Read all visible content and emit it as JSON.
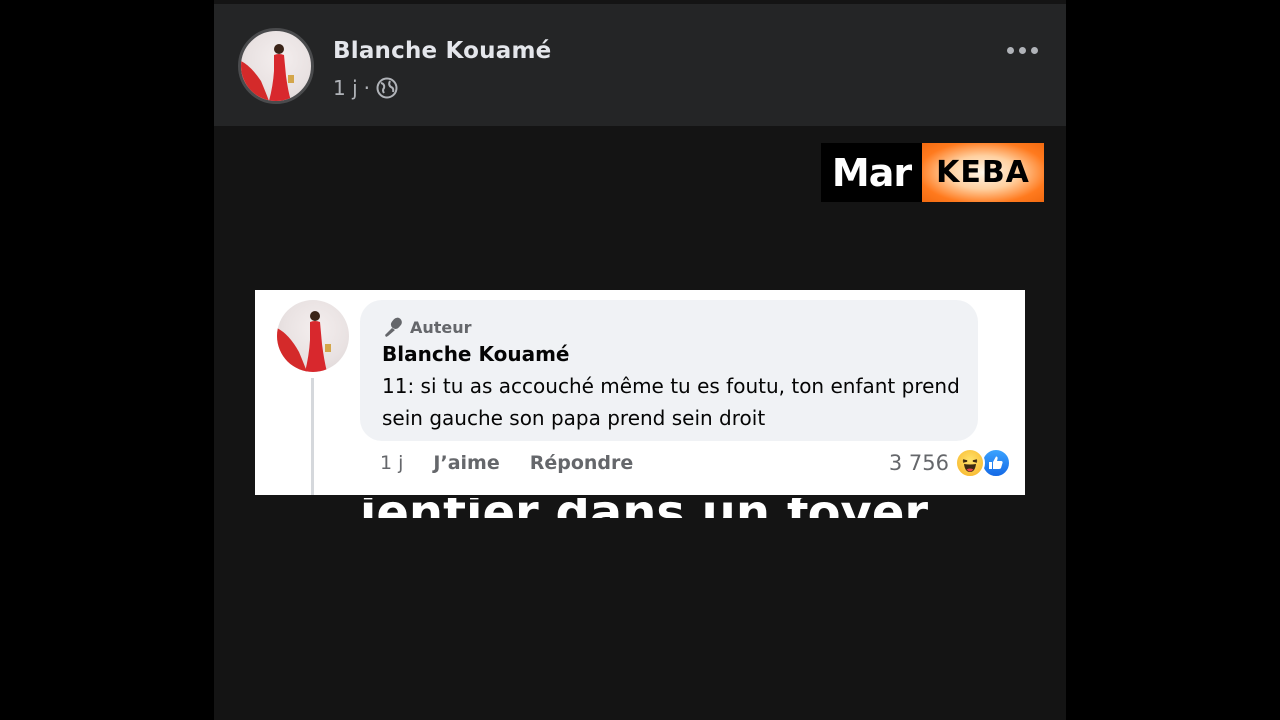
{
  "post": {
    "author": "Blanche Kouamé",
    "time": "1 j",
    "separator": "·",
    "privacy_icon": "globe-icon",
    "menu_icon": "more-horizontal-icon"
  },
  "logo": {
    "left_text": "Mar",
    "right_text": "KEBA"
  },
  "background_caption": "ientier dans un foyer",
  "comment": {
    "badge": "Auteur",
    "badge_icon": "microphone-icon",
    "author": "Blanche Kouamé",
    "text": "11: si tu as accouché même tu es foutu, ton enfant prend sein gauche son papa prend sein droit",
    "time": "1 j",
    "like_label": "J’aime",
    "reply_label": "Répondre",
    "reaction_count": "3 756",
    "reaction_icons": [
      "haha-icon",
      "like-icon"
    ]
  },
  "colors": {
    "header_bg": "#242526",
    "body_bg": "#141414",
    "bubble_bg": "#f0f2f5",
    "like_blue": "#1877f2",
    "logo_orange": "#f26a10"
  }
}
